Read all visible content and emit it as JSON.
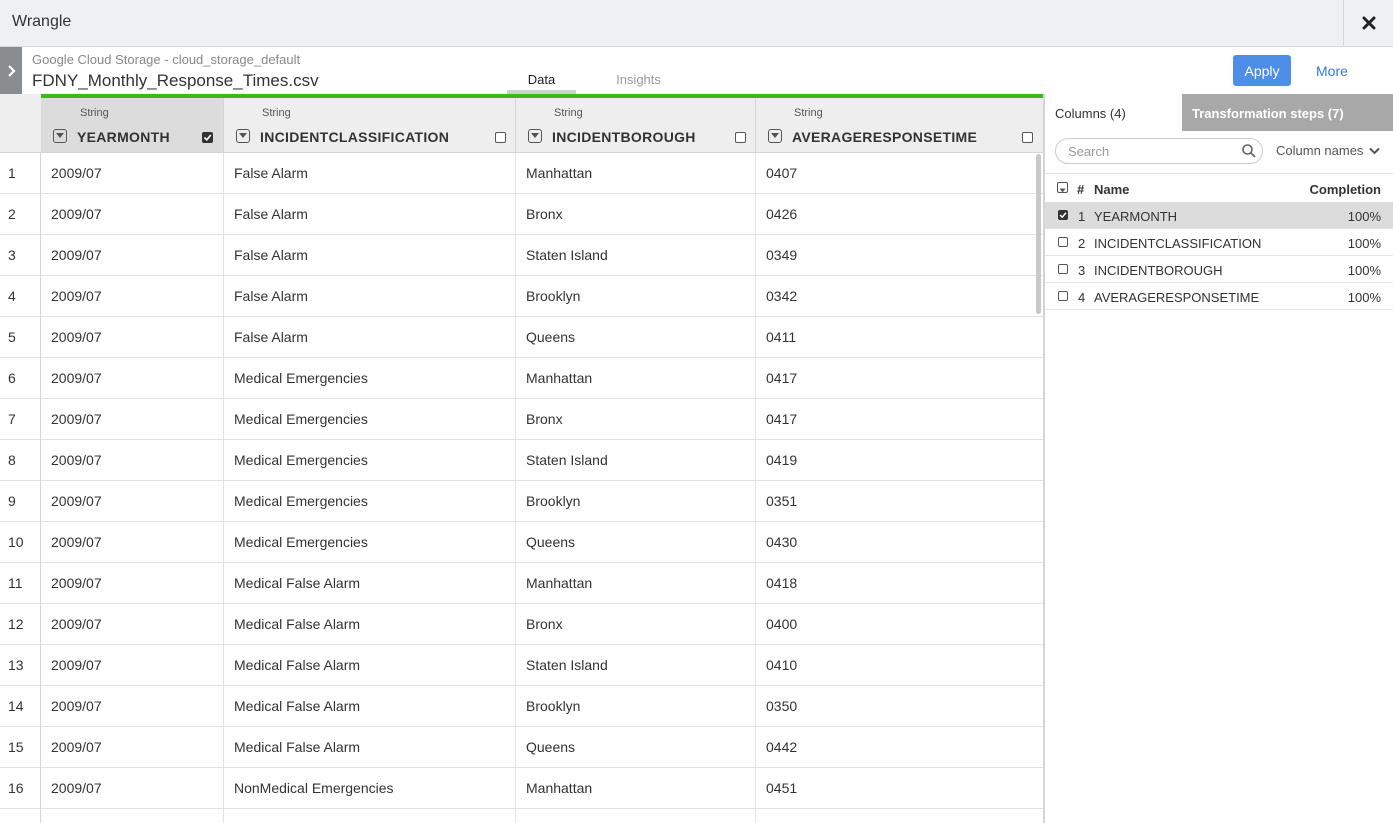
{
  "window": {
    "title": "Wrangle"
  },
  "source": {
    "location": "Google Cloud Storage - cloud_storage_default",
    "filename": "FDNY_Monthly_Response_Times.csv"
  },
  "tabs": {
    "data": "Data",
    "insights": "Insights"
  },
  "actions": {
    "apply": "Apply",
    "more": "More"
  },
  "columns": [
    {
      "type": "String",
      "name": "YEARMONTH",
      "selected": true
    },
    {
      "type": "String",
      "name": "INCIDENTCLASSIFICATION",
      "selected": false
    },
    {
      "type": "String",
      "name": "INCIDENTBOROUGH",
      "selected": false
    },
    {
      "type": "String",
      "name": "AVERAGERESPONSETIME",
      "selected": false
    }
  ],
  "rows": [
    [
      "1",
      "2009/07",
      "False Alarm",
      "Manhattan",
      "0407"
    ],
    [
      "2",
      "2009/07",
      "False Alarm",
      "Bronx",
      "0426"
    ],
    [
      "3",
      "2009/07",
      "False Alarm",
      "Staten Island",
      "0349"
    ],
    [
      "4",
      "2009/07",
      "False Alarm",
      "Brooklyn",
      "0342"
    ],
    [
      "5",
      "2009/07",
      "False Alarm",
      "Queens",
      "0411"
    ],
    [
      "6",
      "2009/07",
      "Medical Emergencies",
      "Manhattan",
      "0417"
    ],
    [
      "7",
      "2009/07",
      "Medical Emergencies",
      "Bronx",
      "0417"
    ],
    [
      "8",
      "2009/07",
      "Medical Emergencies",
      "Staten Island",
      "0419"
    ],
    [
      "9",
      "2009/07",
      "Medical Emergencies",
      "Brooklyn",
      "0351"
    ],
    [
      "10",
      "2009/07",
      "Medical Emergencies",
      "Queens",
      "0430"
    ],
    [
      "11",
      "2009/07",
      "Medical False Alarm",
      "Manhattan",
      "0418"
    ],
    [
      "12",
      "2009/07",
      "Medical False Alarm",
      "Bronx",
      "0400"
    ],
    [
      "13",
      "2009/07",
      "Medical False Alarm",
      "Staten Island",
      "0410"
    ],
    [
      "14",
      "2009/07",
      "Medical False Alarm",
      "Brooklyn",
      "0350"
    ],
    [
      "15",
      "2009/07",
      "Medical False Alarm",
      "Queens",
      "0442"
    ],
    [
      "16",
      "2009/07",
      "NonMedical Emergencies",
      "Manhattan",
      "0451"
    ],
    [
      "",
      "",
      "",
      "",
      ""
    ]
  ],
  "panel": {
    "columns_tab": "Columns (4)",
    "steps_tab": "Transformation steps (7)",
    "search_placeholder": "Search",
    "sort_label": "Column names",
    "list_header": {
      "hash": "#",
      "name": "Name",
      "completion": "Completion"
    },
    "items": [
      {
        "index": "1",
        "name": "YEARMONTH",
        "completion": "100%",
        "checked": true
      },
      {
        "index": "2",
        "name": "INCIDENTCLASSIFICATION",
        "completion": "100%",
        "checked": false
      },
      {
        "index": "3",
        "name": "INCIDENTBOROUGH",
        "completion": "100%",
        "checked": false
      },
      {
        "index": "4",
        "name": "AVERAGERESPONSETIME",
        "completion": "100%",
        "checked": false
      }
    ]
  },
  "colors": {
    "accent": "#4d8ee8",
    "progress": "#3bba17",
    "link": "#2e7bd6"
  },
  "icons": [
    "close-icon",
    "chevron-right-icon",
    "dropdown-icon",
    "checkbox-icon",
    "search-icon",
    "chevron-down-icon"
  ]
}
